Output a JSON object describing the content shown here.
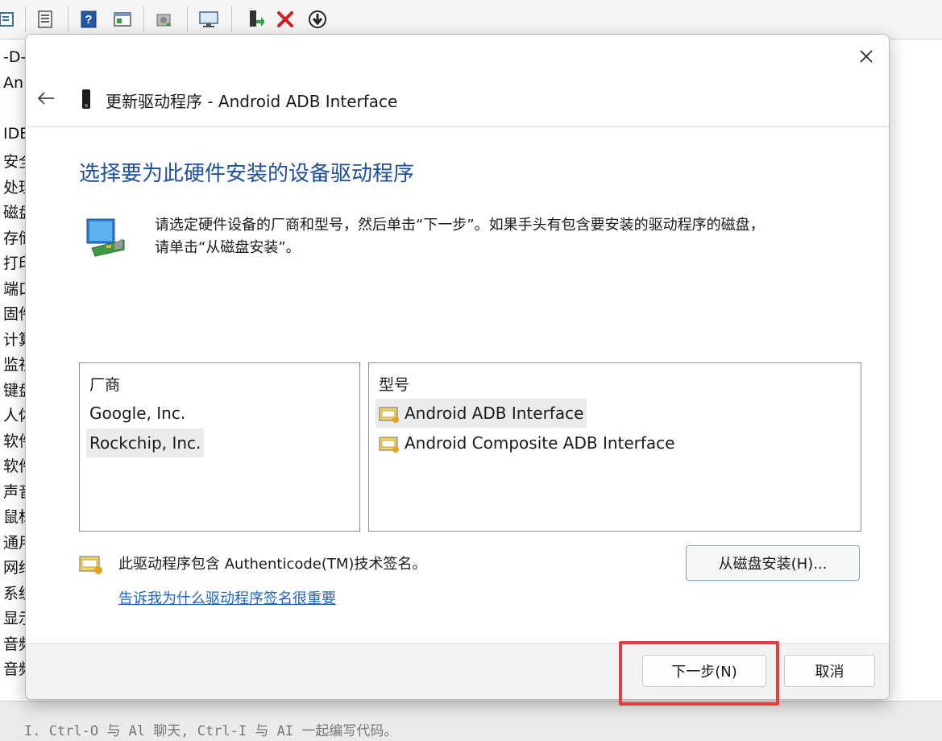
{
  "background_window": {
    "toolbar_icons": [
      "properties-icon",
      "document-icon",
      "help-icon",
      "console-icon",
      "scan-hardware-icon",
      "monitor-icon",
      "update-driver-icon",
      "uninstall-icon",
      "disable-icon"
    ],
    "tree_items": [
      "-D-",
      "An",
      "",
      "IDE",
      "安全",
      "处理",
      "磁盘",
      "存储",
      "打印",
      "端口",
      "固件",
      "计算",
      "监视",
      "键盘",
      "人体",
      "软件",
      "软件",
      "声音",
      "鼠标",
      "通用",
      "网络",
      "系统",
      "显示",
      "音频",
      "音频"
    ],
    "status_text": "I. Ctrl-O  与 Al  聊天, Ctrl-I  与 AI  一起编写代码。"
  },
  "dialog": {
    "title": "更新驱动程序 - Android ADB Interface",
    "heading": "选择要为此硬件安装的设备驱动程序",
    "description_line1": "请选定硬件设备的厂商和型号，然后单击“下一步”。如果手头有包含要安装的驱动程序的磁盘，",
    "description_line2": "请单击“从磁盘安装”。",
    "manufacturer_header": "厂商",
    "manufacturers": [
      "Google, Inc.",
      "Rockchip, Inc."
    ],
    "selected_manufacturer": "Rockchip, Inc.",
    "model_header": "型号",
    "models": [
      "Android ADB Interface",
      "Android Composite ADB Interface"
    ],
    "selected_model": "Android ADB Interface",
    "signed_text": "此驱动程序包含 Authenticode(TM)技术签名。",
    "signing_link": "告诉我为什么驱动程序签名很重要",
    "have_disk_button": "从磁盘安装(H)...",
    "next_button": "下一步(N)",
    "cancel_button": "取消"
  },
  "colors": {
    "heading_blue": "#1f4e9a",
    "link_blue": "#1a64c8",
    "highlight_red": "#e53d3d"
  }
}
